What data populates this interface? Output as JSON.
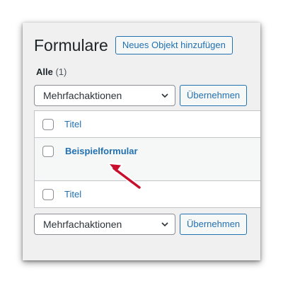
{
  "page": {
    "title": "Formulare",
    "add_new_label": "Neues Objekt hinzufügen"
  },
  "views": {
    "all_label": "Alle",
    "all_count": "(1)"
  },
  "bulk_actions": {
    "selected": "Mehrfachaktionen",
    "apply_label": "Übernehmen"
  },
  "table": {
    "column_title": "Titel",
    "rows": [
      {
        "title": "Beispielformular"
      }
    ]
  },
  "colors": {
    "link": "#2271b1",
    "annotation_arrow": "#c8102e",
    "background": "#f0f0f1"
  },
  "icons": {
    "select_arrow": "chevron-down-icon",
    "annotation": "pointer-arrow-icon"
  }
}
